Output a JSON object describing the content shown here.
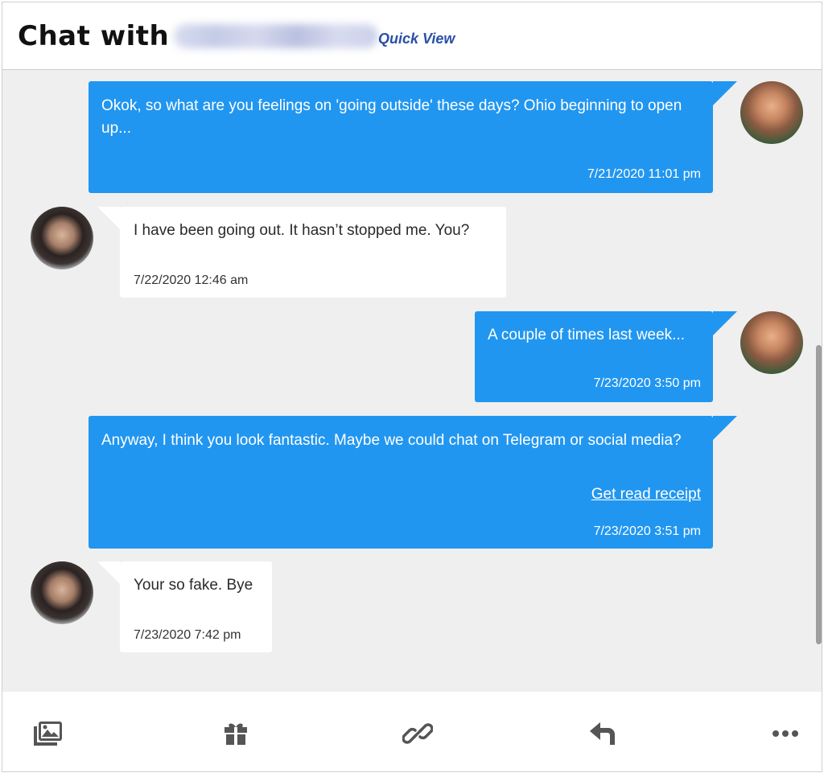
{
  "header": {
    "title_prefix": "Chat with",
    "quick_view_label": "Quick View"
  },
  "messages": [
    {
      "direction": "out",
      "text": "Okok, so what are you feelings on 'going outside' these days? Ohio beginning to open up...",
      "time": "7/21/2020 11:01 pm"
    },
    {
      "direction": "in",
      "text": "I have been going out. It hasn’t stopped me. You?",
      "time": "7/22/2020 12:46 am"
    },
    {
      "direction": "out",
      "text": "A couple of times last week...",
      "time": "7/23/2020 3:50 pm"
    },
    {
      "direction": "out",
      "text": "Anyway, I think you look fantastic. Maybe we could chat on Telegram or social media?",
      "read_receipt_label": "Get read receipt",
      "time": "7/23/2020 3:51 pm"
    },
    {
      "direction": "in",
      "text": "Your so fake. Bye",
      "time": "7/23/2020 7:42 pm"
    }
  ],
  "toolbar": {
    "icons": [
      "photos-icon",
      "gift-icon",
      "link-icon",
      "reply-icon",
      "more-icon"
    ]
  },
  "colors": {
    "outgoing_bubble": "#2196f0",
    "incoming_bubble": "#ffffff",
    "chat_background": "#efefef",
    "quick_view_link": "#2a4fa8",
    "toolbar_icon": "#555555"
  }
}
